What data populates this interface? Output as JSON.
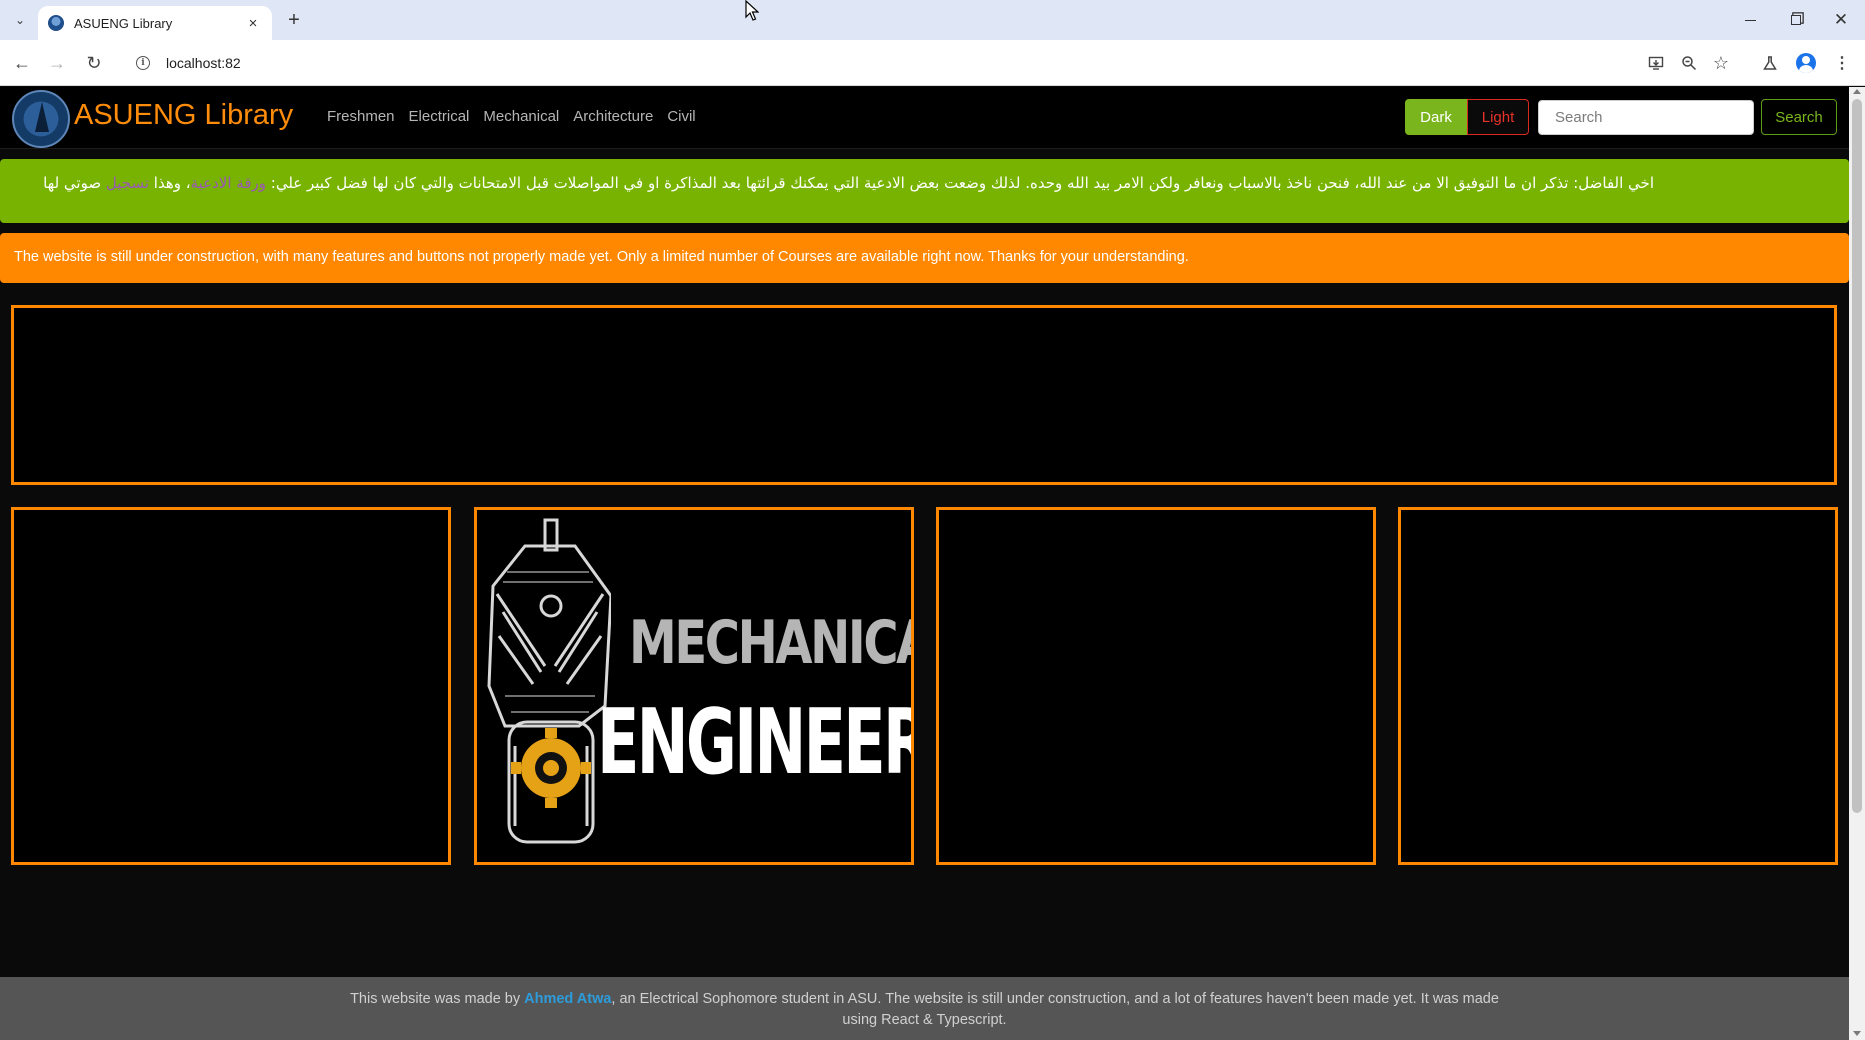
{
  "browser": {
    "tab_title": "ASUENG Library",
    "new_tab_symbol": "+",
    "close_tab_symbol": "×",
    "url": "localhost:82"
  },
  "navbar": {
    "brand": "ASUENG Library",
    "links": [
      {
        "label": "Freshmen"
      },
      {
        "label": "Electrical"
      },
      {
        "label": "Mechanical"
      },
      {
        "label": "Architecture"
      },
      {
        "label": "Civil"
      }
    ],
    "dark_label": "Dark",
    "light_label": "Light",
    "search_placeholder": "Search",
    "search_button_label": "Search"
  },
  "green_banner": {
    "text_main": "اخي الفاضل: تذكر ان ما التوفيق الا من عند الله، فنحن ناخذ بالاسباب ونعافر ولكن الامر بيد الله وحده. لذلك وضعت بعض الادعية التي يمكنك قرائتها بعد المذاكرة او في المواصلات قبل الامتحانات والتي كان لها فضل كبير علي:",
    "link_1": "ورقة الادعية",
    "text_mid": "، وهذا",
    "link_2": "تسجيل",
    "text_end": "صوتي لها"
  },
  "orange_banner": {
    "text": "The website is still under construction, with many features and buttons not properly made yet. Only a limited number of Courses are available right now. Thanks for your understanding."
  },
  "course_cards": [
    {
      "title": "",
      "subtitle": ""
    },
    {
      "title": "MECHANICAL",
      "subtitle": "ENGINEERING"
    },
    {
      "title": "",
      "subtitle": ""
    },
    {
      "title": "",
      "subtitle": ""
    }
  ],
  "footer": {
    "text_before": "This website was made by",
    "author": "Ahmed Atwa",
    "text_after": ", an Electrical Sophomore student in ASU. The website is still under construction, and a lot of features haven't been made yet. It was made using React & Typescript."
  },
  "colors": {
    "accent_orange": "#ff8800",
    "accent_green": "#77b300",
    "danger_red": "#e8322a",
    "link_blue": "#2d9cdb",
    "link_purple": "#9b59b6"
  },
  "icons": {
    "tab_search": "chevron-down-icon",
    "favicon": "asueng-logo-icon",
    "window_controls": [
      "minimize-icon",
      "restore-icon",
      "close-icon"
    ],
    "nav": [
      "back-arrow-icon",
      "forward-arrow-icon",
      "reload-icon"
    ],
    "toolbar": [
      "install-app-icon",
      "zoom-icon",
      "bookmark-star-icon",
      "labs-flask-icon",
      "profile-icon",
      "menu-kebab-icon"
    ]
  }
}
